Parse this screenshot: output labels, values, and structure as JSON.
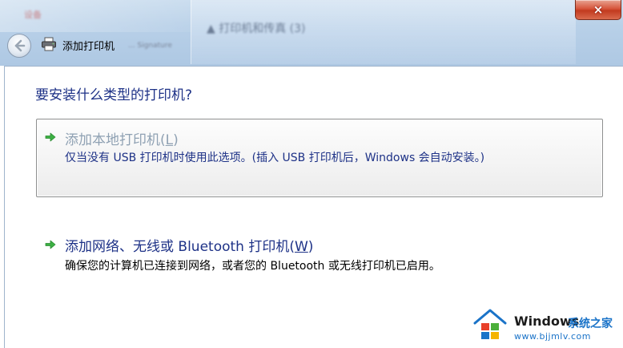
{
  "window": {
    "title": "添加打印机",
    "close_label": "×",
    "background_left_text": "设备",
    "background_mid_text": "... Signature",
    "background_right_text": "▲ 打印机和传真 (3)"
  },
  "main": {
    "question": "要安装什么类型的打印机?",
    "options": [
      {
        "title_prefix": "添加本地打印机(",
        "title_key": "L",
        "title_suffix": ")",
        "description": "仅当没有 USB 打印机时使用此选项。(插入 USB 打印机后，Windows 会自动安装。)",
        "title_color": "#8fa1b3",
        "description_color": "#1e3287"
      },
      {
        "title_prefix": "添加网络、无线或 Bluetooth 打印机(",
        "title_key": "W",
        "title_suffix": ")",
        "description": "确保您的计算机已连接到网络，或者您的 Bluetooth 或无线打印机已启用。",
        "title_color": "#1e3287",
        "description_color": "#000000"
      }
    ]
  },
  "watermark": {
    "brand": "Windows",
    "brand_cn": "系统之家",
    "url": "www.bjjmlv.com"
  },
  "colors": {
    "heading": "#1e3287",
    "arrow_green": "#3cb043",
    "close_red": "#c23a1f"
  }
}
